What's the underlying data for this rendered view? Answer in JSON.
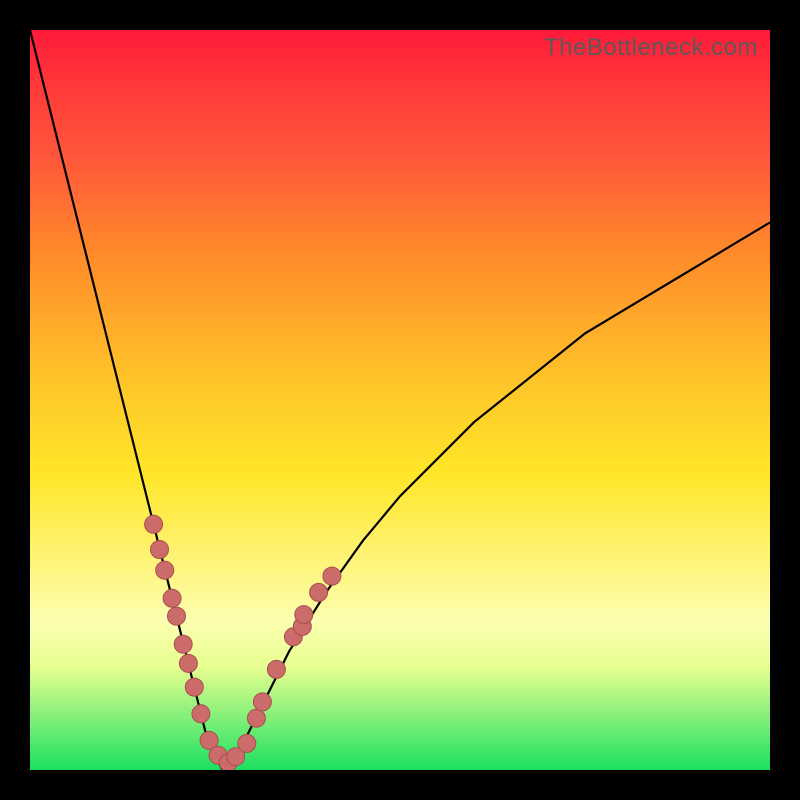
{
  "watermark": "TheBottleneck.com",
  "colors": {
    "frame": "#000000",
    "curve": "#000000",
    "dot_fill": "#cb6c6b",
    "dot_stroke": "#a94e4d",
    "gradient_top": "#ff1a3a",
    "gradient_bottom": "#1be060"
  },
  "chart_data": {
    "type": "line",
    "title": "",
    "xlabel": "",
    "ylabel": "",
    "xlim": [
      0,
      100
    ],
    "ylim": [
      0,
      100
    ],
    "notes": "V-shaped bottleneck curve; y≈0 at trough near x≈26. Left branch rises to y≈100 as x→0; right branch rises to y≈74 as x→100. Pink markers cluster on both branches near the trough (roughly y in [7, 34]).",
    "series": [
      {
        "name": "bottleneck-curve",
        "x": [
          0,
          2,
          4,
          6,
          8,
          10,
          12,
          14,
          16,
          18,
          20,
          22,
          24,
          26,
          28,
          30,
          32,
          35,
          40,
          45,
          50,
          55,
          60,
          65,
          70,
          75,
          80,
          85,
          90,
          95,
          100
        ],
        "y": [
          100,
          92,
          84,
          76,
          68,
          60,
          52,
          44,
          36,
          28,
          20,
          12,
          4,
          0,
          2,
          6,
          10,
          16,
          24,
          31,
          37,
          42,
          47,
          51,
          55,
          59,
          62,
          65,
          68,
          71,
          74
        ]
      }
    ],
    "markers": [
      {
        "x": 16.7,
        "y": 33.2
      },
      {
        "x": 17.5,
        "y": 29.8
      },
      {
        "x": 18.2,
        "y": 27.0
      },
      {
        "x": 19.2,
        "y": 23.2
      },
      {
        "x": 19.8,
        "y": 20.8
      },
      {
        "x": 20.7,
        "y": 17.0
      },
      {
        "x": 21.4,
        "y": 14.4
      },
      {
        "x": 22.2,
        "y": 11.2
      },
      {
        "x": 23.1,
        "y": 7.6
      },
      {
        "x": 24.2,
        "y": 4.0
      },
      {
        "x": 25.4,
        "y": 2.0
      },
      {
        "x": 26.8,
        "y": 1.0
      },
      {
        "x": 27.8,
        "y": 1.8
      },
      {
        "x": 29.3,
        "y": 3.6
      },
      {
        "x": 30.6,
        "y": 7.0
      },
      {
        "x": 31.4,
        "y": 9.2
      },
      {
        "x": 33.3,
        "y": 13.6
      },
      {
        "x": 35.6,
        "y": 18.0
      },
      {
        "x": 36.8,
        "y": 19.4
      },
      {
        "x": 37.0,
        "y": 21.0
      },
      {
        "x": 39.0,
        "y": 24.0
      },
      {
        "x": 40.8,
        "y": 26.2
      }
    ]
  }
}
